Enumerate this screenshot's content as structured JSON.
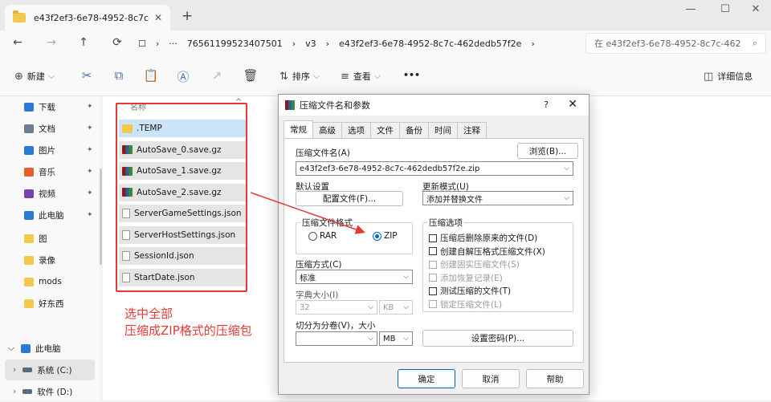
{
  "window": {
    "tab_title": "e43f2ef3-6e78-4952-8c7c-462",
    "tab_close": "✕",
    "new_tab": "+",
    "controls": {
      "minimize": "—",
      "maximize": "☐",
      "close": "✕"
    }
  },
  "nav": {
    "back": "←",
    "forward": "→",
    "up": "↑",
    "refresh": "⟳",
    "monitor_icon": "☐",
    "breadcrumb_sep": "›",
    "more": "···",
    "breadcrumb": [
      "76561199523407501",
      "v3",
      "e43f2ef3-6e78-4952-8c7c-462dedb57f2e"
    ],
    "search_placeholder": "在 e43f2ef3-6e78-4952-8c7c-462",
    "search_icon": "⌕"
  },
  "toolbar": {
    "new_label": "新建",
    "new_icon": "⊕",
    "sort_label": "排序",
    "view_label": "查看",
    "more": "•••",
    "details_label": "详细信息",
    "icons": [
      "cut-icon",
      "copy-icon",
      "paste-icon",
      "rename-icon",
      "share-icon",
      "delete-icon"
    ]
  },
  "sidebar": {
    "pinned": [
      {
        "label": "下载",
        "color": "#2a7ad5"
      },
      {
        "label": "文档",
        "color": "#6b7c93"
      },
      {
        "label": "图片",
        "color": "#2a7ad5"
      },
      {
        "label": "音乐",
        "color": "#e85d2a"
      },
      {
        "label": "视频",
        "color": "#7a3fb0"
      },
      {
        "label": "此电脑",
        "color": "#2a7ad5"
      }
    ],
    "folders": [
      {
        "label": "图",
        "color": "#f2c94c"
      },
      {
        "label": "录像",
        "color": "#f2c94c"
      },
      {
        "label": "mods",
        "color": "#f2c94c"
      },
      {
        "label": "好东西",
        "color": "#f2c94c"
      }
    ],
    "this_pc": "此电脑",
    "drives": [
      {
        "label": "系统 (C:)"
      },
      {
        "label": "软件 (D:)"
      }
    ],
    "pin_glyph": "📌"
  },
  "content": {
    "column_header": "名称",
    "sort_caret": "^",
    "files": [
      {
        "name": ".TEMP",
        "type": "folder"
      },
      {
        "name": "AutoSave_0.save.gz",
        "type": "rar"
      },
      {
        "name": "AutoSave_1.save.gz",
        "type": "rar"
      },
      {
        "name": "AutoSave_2.save.gz",
        "type": "rar"
      },
      {
        "name": "ServerGameSettings.json",
        "type": "doc"
      },
      {
        "name": "ServerHostSettings.json",
        "type": "doc"
      },
      {
        "name": "SessionId.json",
        "type": "doc"
      },
      {
        "name": "StartDate.json",
        "type": "doc"
      }
    ]
  },
  "annotation": {
    "line1": "选中全部",
    "line2": "压缩成ZIP格式的压缩包",
    "color": "#e53935"
  },
  "dialog": {
    "title": "压缩文件名和参数",
    "help": "?",
    "close": "✕",
    "tabs": [
      "常规",
      "高级",
      "选项",
      "文件",
      "备份",
      "时间",
      "注释"
    ],
    "archive_name_label": "压缩文件名(A)",
    "browse": "浏览(B)...",
    "archive_name": "e43f2ef3-6e78-4952-8c7c-462dedb57f2e.zip",
    "default_settings_label": "默认设置",
    "profiles_button": "配置文件(F)...",
    "update_mode_label": "更新模式(U)",
    "update_mode": "添加并替换文件",
    "format_label": "压缩文件格式",
    "format_rar": "RAR",
    "format_zip": "ZIP",
    "method_label": "压缩方式(C)",
    "method": "标准",
    "dict_label": "字典大小(I)",
    "dict_value": "32",
    "dict_unit": "KB",
    "split_label": "切分为分卷(V)，大小",
    "split_unit": "MB",
    "options_label": "压缩选项",
    "options": [
      {
        "label": "压缩后删除原来的文件(D)",
        "enabled": true
      },
      {
        "label": "创建自解压格式压缩文件(X)",
        "enabled": true
      },
      {
        "label": "创建固实压缩文件(S)",
        "enabled": false
      },
      {
        "label": "添加恢复记录(E)",
        "enabled": false
      },
      {
        "label": "测试压缩的文件(T)",
        "enabled": true
      },
      {
        "label": "锁定压缩文件(L)",
        "enabled": false
      }
    ],
    "password_button": "设置密码(P)...",
    "ok": "确定",
    "cancel": "取消",
    "help_button": "帮助",
    "dropdown": "⌵"
  }
}
